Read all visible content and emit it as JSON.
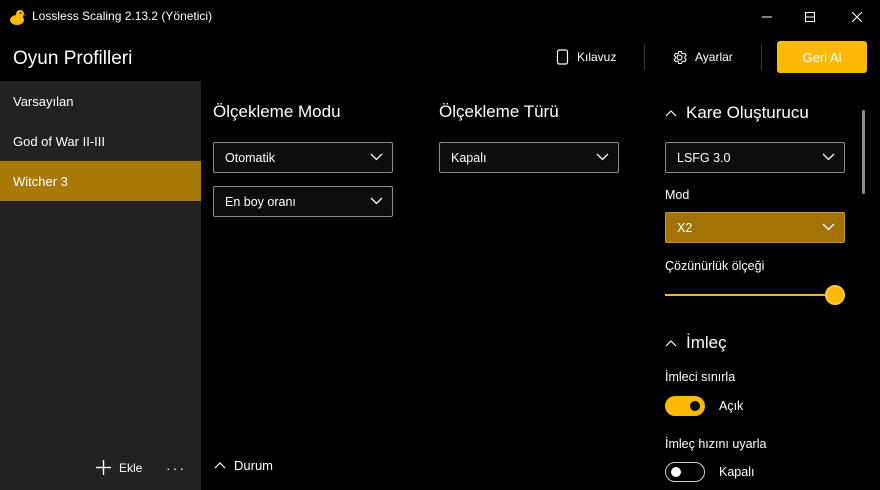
{
  "window": {
    "title": "Lossless Scaling 2.13.2 (Yönetici)",
    "app_icon": "duck-icon",
    "controls": [
      "minimize-icon",
      "maximize-icon",
      "close-icon"
    ]
  },
  "header": {
    "page_title": "Oyun Profilleri",
    "guide_label": "Kılavuz",
    "settings_label": "Ayarlar",
    "revert_label": "Geri Al"
  },
  "sidebar": {
    "profiles": [
      {
        "label": "Varsayılan",
        "active": false
      },
      {
        "label": "God of War II-III",
        "active": false
      },
      {
        "label": "Witcher 3",
        "active": true
      }
    ],
    "add_label": "Ekle",
    "more_label": "···"
  },
  "scaling_mode": {
    "title": "Ölçekleme Modu",
    "mode_value": "Otomatik",
    "aspect_value": "En boy oranı"
  },
  "scaling_type": {
    "title": "Ölçekleme Türü",
    "value": "Kapalı"
  },
  "frame_gen": {
    "title": "Kare Oluşturucu",
    "type_value": "LSFG 3.0",
    "mode_label": "Mod",
    "mode_value": "X2",
    "resolution_label": "Çözünürlük ölçeği",
    "resolution_scale": 1.0
  },
  "cursor": {
    "title": "İmleç",
    "clip_label": "İmleci sınırla",
    "clip_state": "Açık",
    "clip_on": true,
    "speed_label": "İmleç hızını uyarla",
    "speed_state": "Kapalı",
    "speed_on": false
  },
  "status": {
    "label": "Durum"
  },
  "colors": {
    "accent": "#ffb900",
    "selected_profile": "#a87a04",
    "sidebar_bg": "#222222",
    "background": "#000000"
  }
}
